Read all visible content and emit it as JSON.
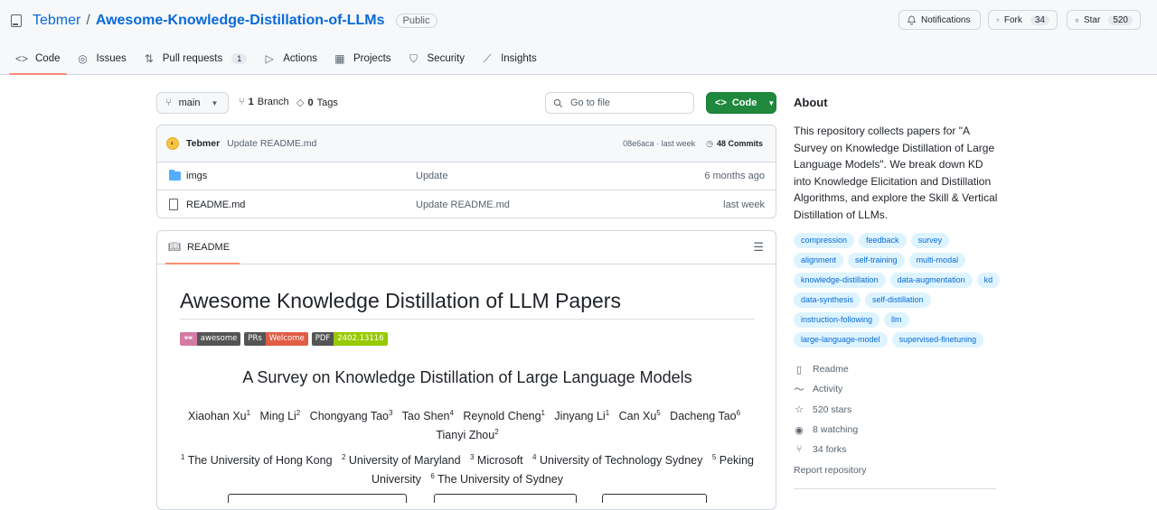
{
  "repo": {
    "owner": "Tebmer",
    "name": "Awesome-Knowledge-Distillation-of-LLMs",
    "visibility": "Public"
  },
  "header_buttons": {
    "notifications": "Notifications",
    "fork": "Fork",
    "fork_count": "34",
    "star": "Star",
    "star_count": "520"
  },
  "tabs": [
    {
      "label": "Code",
      "icon": "code-icon"
    },
    {
      "label": "Issues",
      "icon": "issue-icon"
    },
    {
      "label": "Pull requests",
      "icon": "pull-request-icon",
      "count": "1"
    },
    {
      "label": "Actions",
      "icon": "play-icon"
    },
    {
      "label": "Projects",
      "icon": "table-icon"
    },
    {
      "label": "Security",
      "icon": "shield-icon"
    },
    {
      "label": "Insights",
      "icon": "graph-icon"
    }
  ],
  "branch": {
    "current": "main",
    "branches_count": "1",
    "branches_label": "Branch",
    "tags_count": "0",
    "tags_label": "Tags",
    "goto_placeholder": "Go to file",
    "code_button": "Code"
  },
  "latest_commit": {
    "author": "Tebmer",
    "message": "Update README.md",
    "hash_time": "08e6aca · last week",
    "commits_count": "48 Commits"
  },
  "files": [
    {
      "name": "imgs",
      "type": "folder",
      "commit": "Update",
      "time": "6 months ago"
    },
    {
      "name": "README.md",
      "type": "file",
      "commit": "Update README.md",
      "time": "last week"
    }
  ],
  "readme": {
    "tab_label": "README",
    "title": "Awesome Knowledge Distillation of LLM Papers",
    "badges": [
      {
        "left": "🕶",
        "right": "awesome",
        "left_color": "#d47aa5",
        "right_color": "#555555"
      },
      {
        "left": "PRs",
        "right": "Welcome",
        "left_color": "#555555",
        "right_color": "#e05d44"
      },
      {
        "left": "PDF",
        "right": "2402.13116",
        "left_color": "#555555",
        "right_color": "#97ca00"
      }
    ],
    "subtitle": "A Survey on Knowledge Distillation of Large Language Models",
    "authors": [
      {
        "name": "Xiaohan Xu",
        "sup": "1"
      },
      {
        "name": "Ming Li",
        "sup": "2"
      },
      {
        "name": "Chongyang Tao",
        "sup": "3"
      },
      {
        "name": "Tao Shen",
        "sup": "4"
      },
      {
        "name": "Reynold Cheng",
        "sup": "1"
      },
      {
        "name": "Jinyang Li",
        "sup": "1"
      },
      {
        "name": "Can Xu",
        "sup": "5"
      },
      {
        "name": "Dacheng Tao",
        "sup": "6"
      },
      {
        "name": "Tianyi Zhou",
        "sup": "2"
      }
    ],
    "affiliations": [
      {
        "sup": "1",
        "name": "The University of Hong Kong"
      },
      {
        "sup": "2",
        "name": "University of Maryland"
      },
      {
        "sup": "3",
        "name": "Microsoft"
      },
      {
        "sup": "4",
        "name": "University of Technology Sydney"
      },
      {
        "sup": "5",
        "name": "Peking University"
      },
      {
        "sup": "6",
        "name": "The University of Sydney"
      }
    ]
  },
  "about": {
    "heading": "About",
    "description": "This repository collects papers for \"A Survey on Knowledge Distillation of Large Language Models\". We break down KD into Knowledge Elicitation and Distillation Algorithms, and explore the Skill & Vertical Distillation of LLMs.",
    "topics": [
      "compression",
      "feedback",
      "survey",
      "alignment",
      "self-training",
      "multi-modal",
      "knowledge-distillation",
      "data-augmentation",
      "kd",
      "data-synthesis",
      "self-distillation",
      "instruction-following",
      "llm",
      "large-language-model",
      "supervised-finetuning"
    ],
    "links": [
      {
        "label": "Readme",
        "icon": "book-icon"
      },
      {
        "label": "Activity",
        "icon": "pulse-icon"
      },
      {
        "label": "520 stars",
        "icon": "star-icon"
      },
      {
        "label": "8 watching",
        "icon": "eye-icon"
      },
      {
        "label": "34 forks",
        "icon": "fork-icon"
      }
    ],
    "report": "Report repository"
  }
}
